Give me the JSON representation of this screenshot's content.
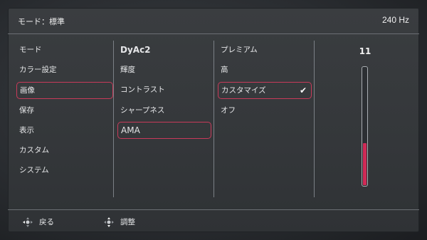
{
  "header": {
    "mode": "モード：標準",
    "refresh_rate": "240 Hz"
  },
  "menu": {
    "items": [
      {
        "label": "モード"
      },
      {
        "label": "カラー設定"
      },
      {
        "label": "画像"
      },
      {
        "label": "保存"
      },
      {
        "label": "表示"
      },
      {
        "label": "カスタム"
      },
      {
        "label": "システム"
      }
    ]
  },
  "submenu": {
    "items": [
      {
        "label": "DyAc2"
      },
      {
        "label": "輝度"
      },
      {
        "label": "コントラスト"
      },
      {
        "label": "シャープネス"
      },
      {
        "label": "AMA"
      }
    ]
  },
  "options": {
    "items": [
      {
        "label": "プレミアム"
      },
      {
        "label": "高"
      },
      {
        "label": "カスタマイズ"
      },
      {
        "label": "オフ"
      }
    ],
    "checked": "カスタマイズ"
  },
  "slider": {
    "value": "11",
    "fill_fraction": 0.36
  },
  "footer": {
    "back_label": "戻る",
    "adjust_label": "調整"
  }
}
